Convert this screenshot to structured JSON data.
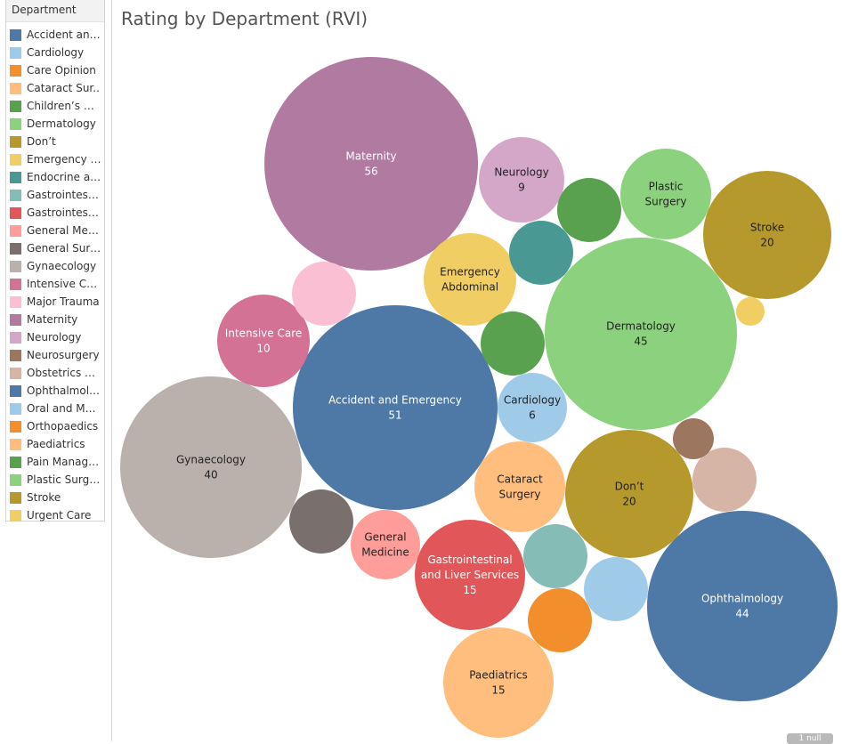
{
  "title": "Rating by Department (RVI)",
  "legend": {
    "title": "Department",
    "items": [
      {
        "label": "Accident and ..",
        "color": "#4e79a7"
      },
      {
        "label": "Cardiology",
        "color": "#a0cbe8"
      },
      {
        "label": "Care Opinion",
        "color": "#f28e2b"
      },
      {
        "label": "Cataract Sur..",
        "color": "#ffbe7d"
      },
      {
        "label": "Children’s & ..",
        "color": "#59a14f"
      },
      {
        "label": "Dermatology",
        "color": "#8cd17d"
      },
      {
        "label": "Don’t",
        "color": "#b6992d"
      },
      {
        "label": "Emergency A..",
        "color": "#f1ce63"
      },
      {
        "label": "Endocrine an..",
        "color": "#499894"
      },
      {
        "label": "Gastrointesti..",
        "color": "#86bcb6"
      },
      {
        "label": "Gastrointesti..",
        "color": "#e15759"
      },
      {
        "label": "General Medi..",
        "color": "#ff9d9a"
      },
      {
        "label": "General Surg..",
        "color": "#79706e"
      },
      {
        "label": "Gynaecology",
        "color": "#bab0ac"
      },
      {
        "label": "Intensive Care",
        "color": "#d37295"
      },
      {
        "label": "Major Trauma",
        "color": "#fabfd2"
      },
      {
        "label": "Maternity",
        "color": "#b07aa1"
      },
      {
        "label": "Neurology",
        "color": "#d4a6c8"
      },
      {
        "label": "Neurosurgery",
        "color": "#9d7660"
      },
      {
        "label": "Obstetrics an..",
        "color": "#d7b5a6"
      },
      {
        "label": "Ophthalmolo..",
        "color": "#4e79a7"
      },
      {
        "label": "Oral and Maxi..",
        "color": "#a0cbe8"
      },
      {
        "label": "Orthopaedics",
        "color": "#f28e2b"
      },
      {
        "label": "Paediatrics",
        "color": "#ffbe7d"
      },
      {
        "label": "Pain Manage..",
        "color": "#59a14f"
      },
      {
        "label": "Plastic Surge..",
        "color": "#8cd17d"
      },
      {
        "label": "Stroke",
        "color": "#b6992d"
      },
      {
        "label": "Urgent Care",
        "color": "#f1ce63"
      }
    ]
  },
  "badge": "1 null",
  "chart_data": {
    "type": "bubble",
    "title": "Rating by Department (RVI)",
    "bubbles": [
      {
        "lines": [
          "Maternity"
        ],
        "value": "56",
        "v": 56,
        "color": "#b07aa1",
        "text": "#ffffff"
      },
      {
        "lines": [
          "Accident and Emergency"
        ],
        "value": "51",
        "v": 51,
        "color": "#4e79a7",
        "text": "#ffffff"
      },
      {
        "lines": [
          "Dermatology"
        ],
        "value": "45",
        "v": 45,
        "color": "#8cd17d",
        "text": "#222222"
      },
      {
        "lines": [
          "Ophthalmology"
        ],
        "value": "44",
        "v": 44,
        "color": "#4e79a7",
        "text": "#ffffff"
      },
      {
        "lines": [
          "Gynaecology"
        ],
        "value": "40",
        "v": 40,
        "color": "#bab0ac",
        "text": "#222222"
      },
      {
        "lines": [
          "Stroke"
        ],
        "value": "20",
        "v": 20,
        "color": "#b6992d",
        "text": "#222222"
      },
      {
        "lines": [
          "Don’t"
        ],
        "value": "20",
        "v": 20,
        "color": "#b6992d",
        "text": "#222222"
      },
      {
        "lines": [
          "Gastrointestinal",
          "and Liver Services"
        ],
        "value": "15",
        "v": 15,
        "color": "#e15759",
        "text": "#ffffff"
      },
      {
        "lines": [
          "Paediatrics"
        ],
        "value": "15",
        "v": 15,
        "color": "#ffbe7d",
        "text": "#222222"
      },
      {
        "lines": [
          "Intensive Care"
        ],
        "value": "10",
        "v": 10,
        "color": "#d37295",
        "text": "#ffffff"
      },
      {
        "lines": [
          "Neurology"
        ],
        "value": "9",
        "v": 9,
        "color": "#d4a6c8",
        "text": "#222222"
      },
      {
        "lines": [
          "Cardiology"
        ],
        "value": "6",
        "v": 6,
        "color": "#a0cbe8",
        "text": "#222222"
      },
      {
        "lines": [
          "Plastic",
          "Surgery"
        ],
        "value": "",
        "v": 9,
        "color": "#8cd17d",
        "text": "#222222"
      },
      {
        "lines": [
          "Emergency",
          "Abdominal"
        ],
        "value": "",
        "v": 9,
        "color": "#f1ce63",
        "text": "#222222"
      },
      {
        "lines": [
          "Cataract",
          "Surgery"
        ],
        "value": "",
        "v": 9,
        "color": "#ffbe7d",
        "text": "#222222"
      },
      {
        "lines": [
          "General",
          "Medicine"
        ],
        "value": "",
        "v": 7,
        "color": "#ff9d9a",
        "text": "#222222"
      },
      {
        "lines": [],
        "value": "",
        "v": 4,
        "color": "#fabfd2",
        "text": "#222222"
      },
      {
        "lines": [],
        "value": "",
        "v": 4,
        "color": "#59a14f",
        "text": "#222222"
      },
      {
        "lines": [],
        "value": "",
        "v": 4,
        "color": "#499894",
        "text": "#222222"
      },
      {
        "lines": [],
        "value": "",
        "v": 4,
        "color": "#59a14f",
        "text": "#222222"
      },
      {
        "lines": [],
        "value": "",
        "v": 4,
        "color": "#79706e",
        "text": "#222222"
      },
      {
        "lines": [],
        "value": "",
        "v": 4,
        "color": "#86bcb6",
        "text": "#222222"
      },
      {
        "lines": [],
        "value": "",
        "v": 4,
        "color": "#a0cbe8",
        "text": "#222222"
      },
      {
        "lines": [],
        "value": "",
        "v": 4,
        "color": "#f28e2b",
        "text": "#222222"
      },
      {
        "lines": [],
        "value": "",
        "v": 4,
        "color": "#d7b5a6",
        "text": "#222222"
      },
      {
        "lines": [],
        "value": "",
        "v": 2,
        "color": "#9d7660",
        "text": "#222222"
      },
      {
        "lines": [],
        "value": "",
        "v": 1,
        "color": "#f1ce63",
        "text": "#222222"
      }
    ]
  }
}
